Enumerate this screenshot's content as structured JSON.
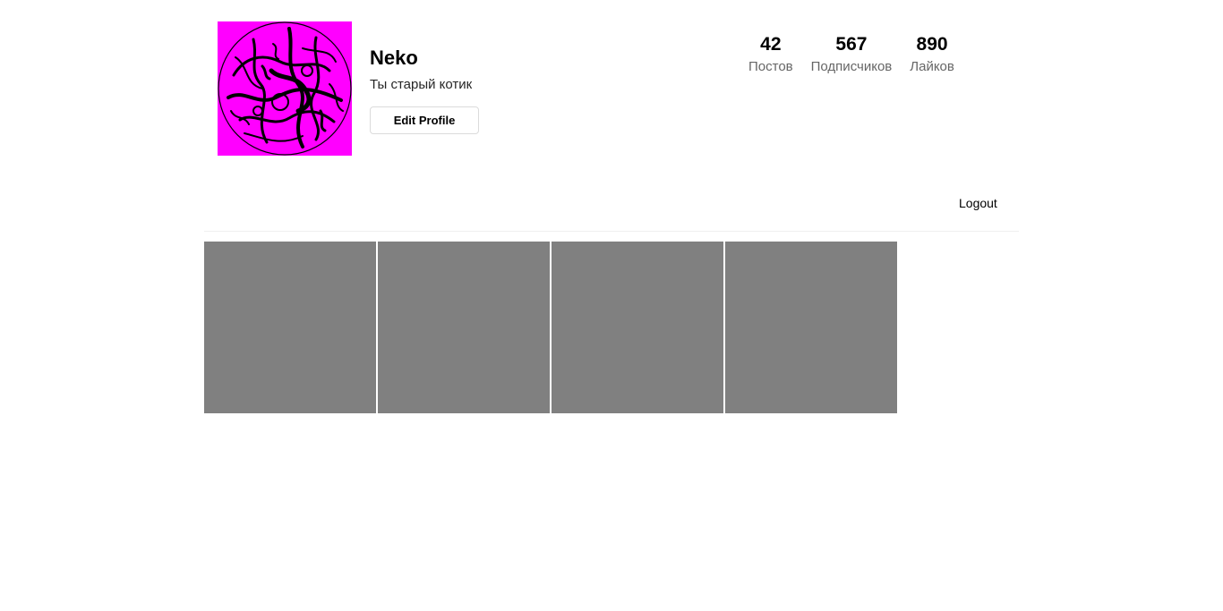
{
  "profile": {
    "username": "Neko",
    "bio": "Ты старый котик",
    "edit_label": "Edit Profile",
    "avatar_color": "#ff00ff"
  },
  "stats": [
    {
      "value": "42",
      "label": "Постов"
    },
    {
      "value": "567",
      "label": "Подписчиков"
    },
    {
      "value": "890",
      "label": "Лайков"
    }
  ],
  "nav": {
    "logout_label": "Logout"
  },
  "posts": {
    "count": 4,
    "placeholder_color": "#808080"
  }
}
